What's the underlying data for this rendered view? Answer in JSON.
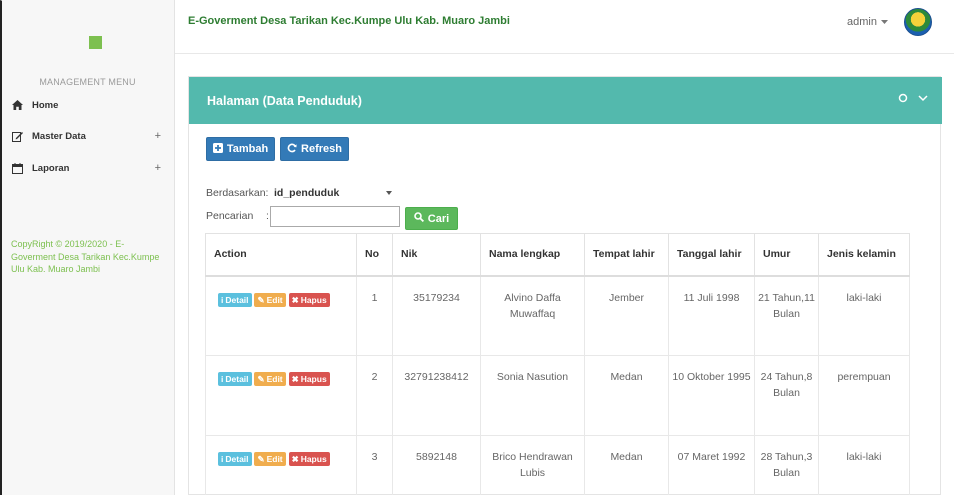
{
  "header": {
    "app_title": "E-Goverment Desa Tarikan Kec.Kumpe Ulu Kab. Muaro Jambi",
    "user_label": "admin"
  },
  "sidebar": {
    "menu_header": "MANAGEMENT MENU",
    "items": [
      {
        "label": "Home",
        "icon": "home-icon"
      },
      {
        "label": "Master Data",
        "icon": "edit-icon",
        "expander": "+"
      },
      {
        "label": "Laporan",
        "icon": "calendar-icon",
        "expander": "+"
      }
    ],
    "copyright": "CopyRight © 2019/2020 - E-Goverment Desa Tarikan Kec.Kumpe Ulu Kab. Muaro Jambi"
  },
  "panel": {
    "title": "Halaman (Data Penduduk)",
    "add_label": "Tambah",
    "refresh_label": "Refresh",
    "filter_label": "Berdasarkan:",
    "filter_value": "id_penduduk",
    "search_label": "Pencarian",
    "search_sep": ":",
    "search_value": "",
    "search_button": "Cari"
  },
  "table": {
    "columns": [
      "Action",
      "No",
      "Nik",
      "Nama lengkap",
      "Tempat lahir",
      "Tanggal lahir",
      "Umur",
      "Jenis kelamin"
    ],
    "action_labels": {
      "detail": "Detail",
      "edit": "Edit",
      "delete": "Hapus"
    },
    "rows": [
      {
        "no": "1",
        "nik": "35179234",
        "nama": "Alvino Daffa Muwaffaq",
        "tempat": "Jember",
        "tanggal": "11 Juli 1998",
        "umur": "21 Tahun,11 Bulan",
        "jk": "laki-laki"
      },
      {
        "no": "2",
        "nik": "32791238412",
        "nama": "Sonia Nasution",
        "tempat": "Medan",
        "tanggal": "10 Oktober 1995",
        "umur": "24 Tahun,8 Bulan",
        "jk": "perempuan"
      },
      {
        "no": "3",
        "nik": "5892148",
        "nama": "Brico Hendrawan Lubis",
        "tempat": "Medan",
        "tanggal": "07 Maret 1992",
        "umur": "28 Tahun,3 Bulan",
        "jk": "laki-laki"
      }
    ]
  },
  "colors": {
    "panel_header": "#53b9ad",
    "primary": "#337ab7",
    "success": "#5cb85c",
    "title_green": "#2e7d32"
  }
}
